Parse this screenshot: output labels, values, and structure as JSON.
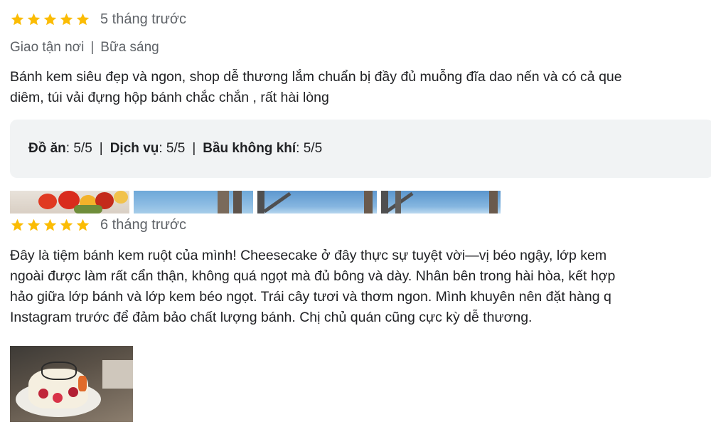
{
  "reviews": [
    {
      "stars": 5,
      "relative_time": "5 tháng trước",
      "service_type": "Giao tận nơi",
      "meal_type": "Bữa sáng",
      "text_lines": [
        "Bánh kem siêu đẹp và ngon, shop dễ thương lắm chuẩn bị đầy đủ muỗng đĩa dao nến và có cả que",
        "diêm, túi vải đựng hộp bánh chắc chắn , rất hài lòng"
      ],
      "sub_ratings": [
        {
          "label": "Đồ ăn",
          "value": "5/5"
        },
        {
          "label": "Dịch vụ",
          "value": "5/5"
        },
        {
          "label": "Bầu không khí",
          "value": "5/5"
        }
      ],
      "photos": [
        "flowers-photo",
        "window-sky-photo",
        "window-sky-photo",
        "window-sky-photo"
      ]
    },
    {
      "stars": 5,
      "relative_time": "6 tháng trước",
      "text_lines": [
        "Đây là tiệm bánh kem ruột của mình! Cheesecake ở đây thực sự tuyệt vời—vị béo ngậy, lớp kem",
        "ngoài được làm rất cẩn thận, không quá ngọt mà đủ bông và dày. Nhân bên trong hài hòa, kết hợp",
        "hảo giữa lớp bánh và lớp kem béo ngọt. Trái cây tươi và thơm ngon. Mình khuyên nên đặt hàng q",
        "Instagram trước để đảm bảo chất lượng bánh. Chị chủ quán cũng cực kỳ dễ thương."
      ],
      "photos": [
        "birthday-cake-photo"
      ]
    }
  ],
  "separator": "|",
  "colors": {
    "star": "#fbbc04",
    "secondary_text": "#5f6368",
    "primary_text": "#202124",
    "ratings_box_bg": "#f1f3f4"
  }
}
